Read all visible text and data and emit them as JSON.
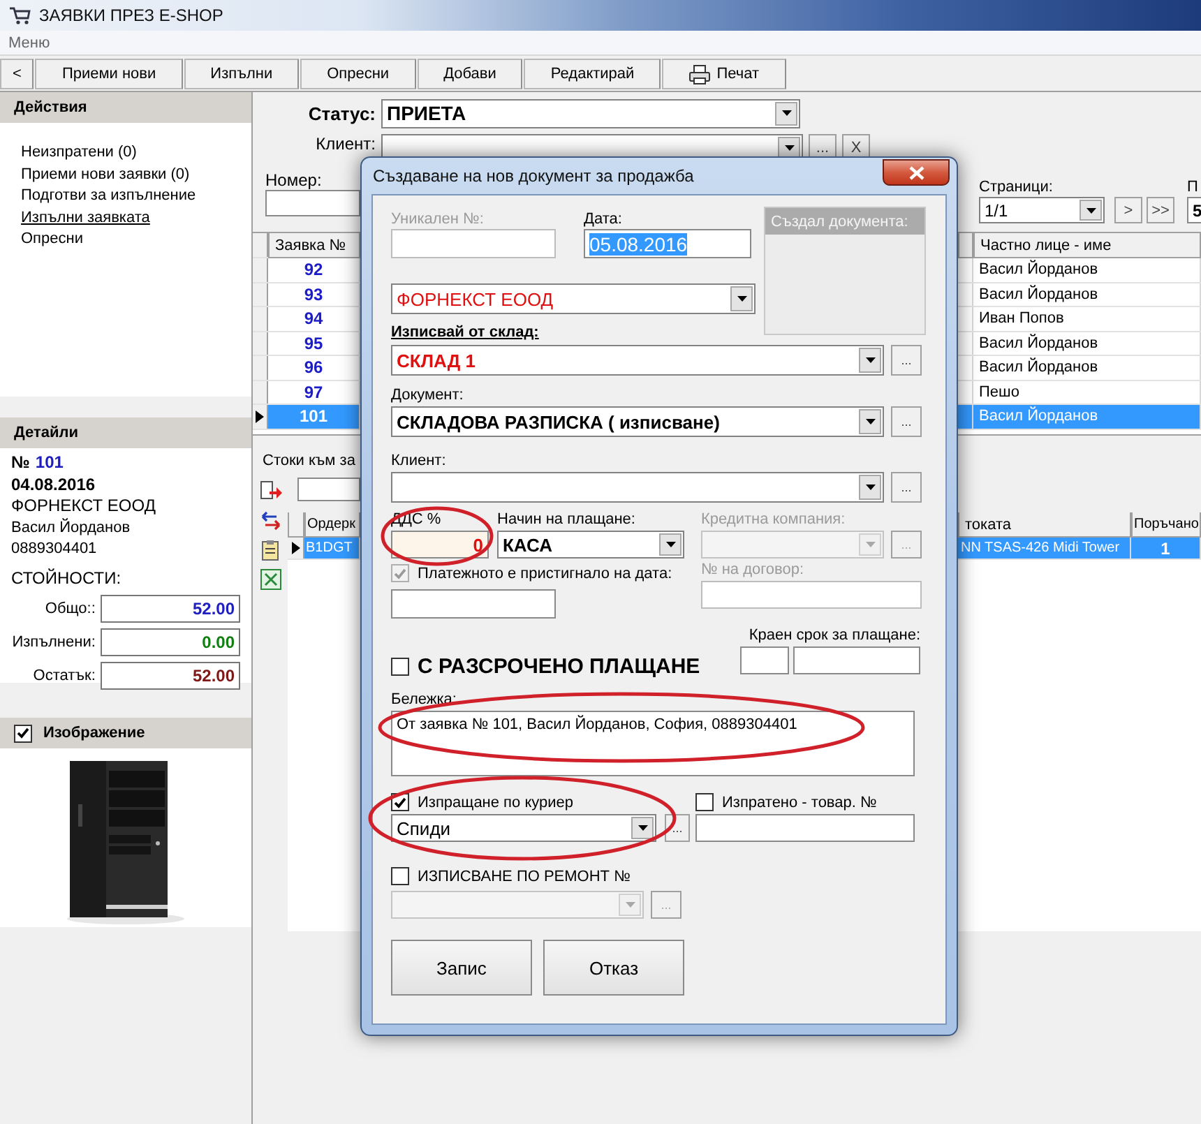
{
  "main_window": {
    "title": "ЗАЯВКИ ПРЕЗ E-SHOP",
    "menu": [
      "Меню"
    ],
    "toolbar": [
      {
        "label": "<",
        "kind": "nav"
      },
      {
        "label": "Приеми нови",
        "kind": "text"
      },
      {
        "label": "Изпълни",
        "kind": "text"
      },
      {
        "label": "Опресни",
        "kind": "text"
      },
      {
        "label": "Добави",
        "kind": "text"
      },
      {
        "label": "Редактирай",
        "kind": "text"
      },
      {
        "label": "Печат",
        "kind": "print"
      }
    ],
    "actions": {
      "title": "Действия",
      "items": [
        {
          "label": "Неизпратени (0)",
          "kind": "text"
        },
        {
          "label": "Приеми нови заявки (0)",
          "kind": "text"
        },
        {
          "label": "Подготви за изпълнение",
          "kind": "text"
        },
        {
          "label": "Изпълни заявката",
          "kind": "link"
        },
        {
          "label": "Опресни",
          "kind": "text"
        }
      ]
    },
    "details": {
      "title": "Детайли",
      "number_label": "№",
      "number": "101",
      "date": "04.08.2016",
      "company": "ФОРНЕКСТ ЕООД",
      "person": "Васил Йорданов",
      "phone": "0889304401",
      "values_title": "СТОЙНОСТИ:",
      "values": [
        {
          "label": "Общо::",
          "value": "52.00",
          "color": "#2020c0"
        },
        {
          "label": "Изпълнени:",
          "value": "0.00",
          "color": "#108010"
        },
        {
          "label": "Остатък:",
          "value": "52.00",
          "color": "#801818"
        }
      ]
    },
    "image_panel": {
      "title": "Изображение",
      "checked": true
    },
    "filters": {
      "status": {
        "label": "Статус:",
        "value": "ПРИЕТА"
      },
      "client": {
        "label": "Клиент:",
        "buttons": [
          "...",
          "X"
        ]
      },
      "number": {
        "label": "Номер:"
      },
      "pages": {
        "label": "Страници:",
        "value": "1/1",
        "buttons": [
          ">",
          ">>"
        ]
      },
      "per_page": {
        "label": "П",
        "value": "5"
      }
    },
    "orders": {
      "columns": [
        "Заявка №",
        "Частно лице - име"
      ],
      "rows": [
        {
          "number": "92",
          "name": "Васил Йорданов",
          "selected": false
        },
        {
          "number": "93",
          "name": "Васил Йорданов",
          "selected": false
        },
        {
          "number": "94",
          "name": "Иван Попов",
          "selected": false
        },
        {
          "number": "95",
          "name": "Васил Йорданов",
          "selected": false
        },
        {
          "number": "96",
          "name": "Васил Йорданов",
          "selected": false
        },
        {
          "number": "97",
          "name": "Пешо",
          "selected": false
        },
        {
          "number": "101",
          "name": "Васил Йорданов",
          "selected": true
        }
      ]
    },
    "goods": {
      "title": "Стоки към за",
      "columns": [
        "Ордерк",
        "токата",
        "Поръчано"
      ],
      "rows": [
        {
          "code": "B1DGT",
          "name": "NN TSAS-426 Midi Tower",
          "ordered": "1",
          "selected": true
        }
      ]
    }
  },
  "dialog": {
    "title": "Създаване на нов документ за продажба",
    "unique": {
      "label": "Уникален №:",
      "disabled": true
    },
    "date": {
      "label": "Дата:",
      "value": "05.08.2016",
      "selected": true
    },
    "creator": {
      "label": "Създал документа:"
    },
    "company": {
      "value": "ФОРНЕКСТ ЕООД"
    },
    "warehouse": {
      "label": "Изписвай от склад:",
      "value": "СКЛАД 1",
      "browse": "..."
    },
    "document": {
      "label": "Документ:",
      "value": "СКЛАДОВА РАЗПИСКА ( изписване)",
      "browse": "..."
    },
    "client": {
      "label": "Клиент:",
      "browse": "..."
    },
    "vat": {
      "label": "ДДС %",
      "value": "0"
    },
    "payment": {
      "label": "Начин на плащане:",
      "value": "КАСА"
    },
    "credit": {
      "label": "Кредитна компания:",
      "browse": "...",
      "disabled": true
    },
    "payment_arrived": {
      "label": "Платежното е пристигнало на дата:",
      "checked": true,
      "disabled": true
    },
    "contract": {
      "label": "№ на договор:",
      "disabled": true
    },
    "deadline": {
      "label": "Краен срок за плащане:"
    },
    "installments": {
      "label": "С РАЗСРОЧЕНО ПЛАЩАНЕ",
      "checked": false
    },
    "note": {
      "label": "Бележка:",
      "value": "От заявка № 101, Васил Йорданов, София, 0889304401"
    },
    "courier": {
      "label": "Изпращане по куриер",
      "checked": true,
      "value": "Спиди",
      "browse": "..."
    },
    "shipped": {
      "label": "Изпратено - товар. №",
      "checked": false
    },
    "repair": {
      "label": "ИЗПИСВАНЕ ПО РЕМОНТ №",
      "checked": false,
      "browse": "...",
      "disabled": true
    },
    "buttons": [
      "Запис",
      "Отказ"
    ]
  }
}
